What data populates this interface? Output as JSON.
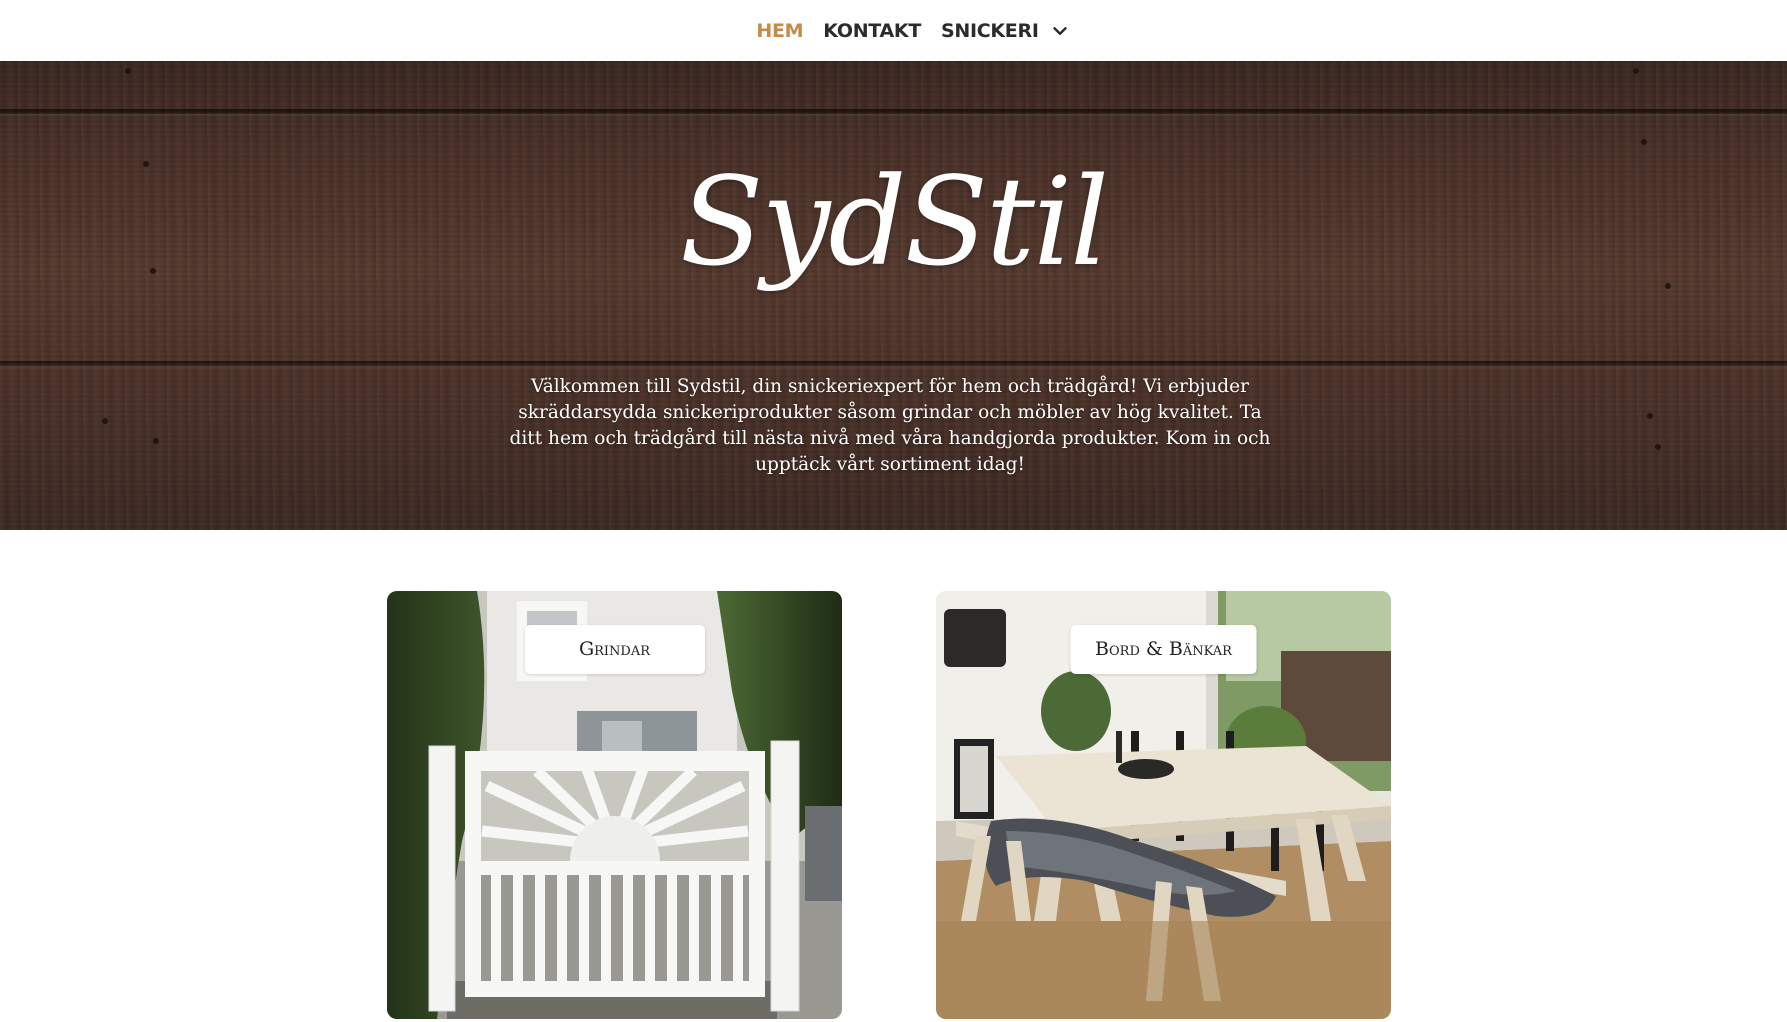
{
  "nav": {
    "items": [
      {
        "label": "HEM",
        "active": true
      },
      {
        "label": "KONTAKT",
        "active": false
      },
      {
        "label": "SNICKERI",
        "active": false,
        "has_dropdown": true,
        "icon": "chevron-down-icon"
      }
    ],
    "active_color": "#c48a4b",
    "text_color": "#2b2b2b"
  },
  "hero": {
    "logo": "SydStil",
    "intro": "Välkommen till Sydstil, din snickeriexpert för hem och trädgård! Vi erbjuder skräddarsydda snickeriprodukter såsom grindar och möbler av hög kvalitet. Ta ditt hem och trädgård till nästa nivå med våra handgjorda produkter. Kom in och upptäck vårt sortiment idag!",
    "background": "dark-wood-planks"
  },
  "cards": [
    {
      "label": "Grindar",
      "image": "white-garden-gate-photo"
    },
    {
      "label": "Bord & Bänkar",
      "image": "wooden-table-and-bench-photo"
    }
  ]
}
